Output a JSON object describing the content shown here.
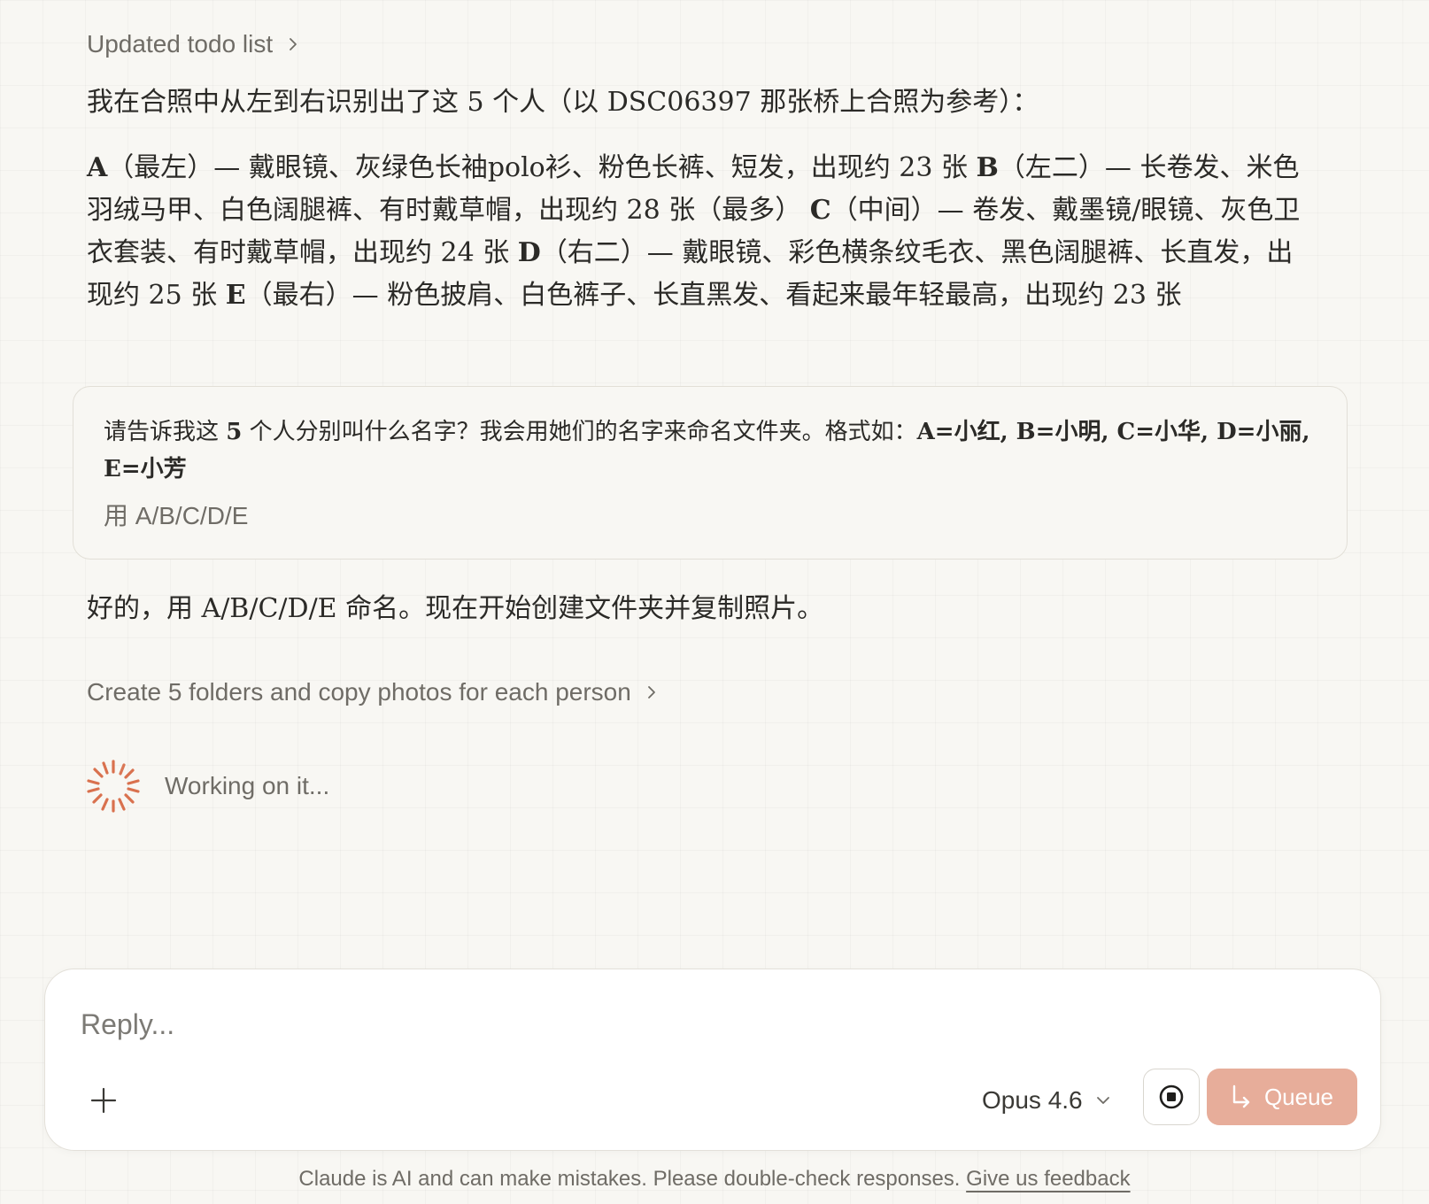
{
  "steps": {
    "todo_label": "Updated todo list",
    "create_folders_label": "Create 5 folders and copy photos for each person"
  },
  "messages": {
    "intro": "我在合照中从左到右识别出了这 5 个人（以 DSC06397 那张桥上合照为参考）：",
    "people": [
      {
        "letter": "A",
        "desc": "（最左）— 戴眼镜、灰绿色长袖polo衫、粉色长裤、短发，出现约 23 张"
      },
      {
        "letter": "B",
        "desc": "（左二）— 长卷发、米色羽绒马甲、白色阔腿裤、有时戴草帽，出现约 28 张（最多）"
      },
      {
        "letter": "C",
        "desc": "（中间）— 卷发、戴墨镜/眼镜、灰色卫衣套装、有时戴草帽，出现约 24 张"
      },
      {
        "letter": "D",
        "desc": "（右二）— 戴眼镜、彩色横条纹毛衣、黑色阔腿裤、长直发，出现约 25 张"
      },
      {
        "letter": "E",
        "desc": "（最右）— 粉色披肩、白色裤子、长直黑发、看起来最年轻最高，出现约 23 张"
      }
    ],
    "question": {
      "part1": "请告诉我这 ",
      "count": "5",
      "part2": " 个人分别叫什么名字？我会用她们的名字来命名文件夹。格式如：",
      "example": "A=小红, B=小明, C=小华, D=小丽, E=小芳",
      "answer": "用 A/B/C/D/E"
    },
    "ok": "好的，用 A/B/C/D/E 命名。现在开始创建文件夹并复制照片。",
    "working": "Working on it..."
  },
  "composer": {
    "placeholder": "Reply...",
    "model": "Opus 4.6",
    "queue_label": "Queue"
  },
  "footer": {
    "disclaimer": "Claude is AI and can make mistakes. Please double-check responses.",
    "feedback": "Give us feedback"
  },
  "icons": {
    "chevron": "chevron-right-icon",
    "spinner": "spinner-icon",
    "plus": "plus-icon",
    "stop": "stop-icon",
    "queue": "enter-arrow-icon"
  },
  "colors": {
    "accent_spinner": "#d9714e",
    "queue_button": "#e7ad9a",
    "background": "#f8f7f3"
  }
}
